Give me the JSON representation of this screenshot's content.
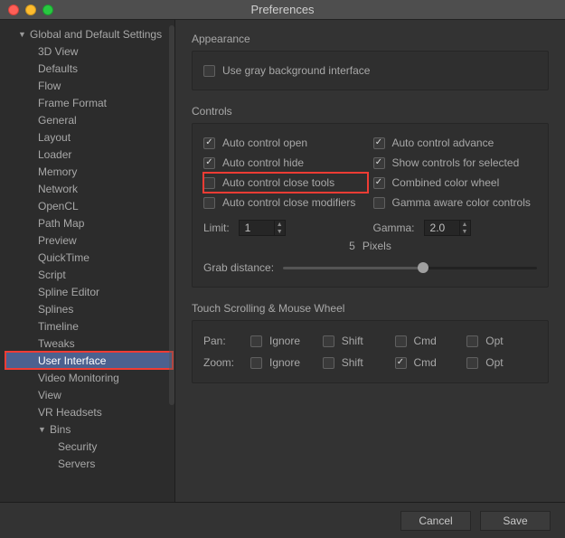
{
  "window": {
    "title": "Preferences"
  },
  "sidebar": {
    "root": {
      "label": "Global and Default Settings"
    },
    "items": [
      "3D View",
      "Defaults",
      "Flow",
      "Frame Format",
      "General",
      "Layout",
      "Loader",
      "Memory",
      "Network",
      "OpenCL",
      "Path Map",
      "Preview",
      "QuickTime",
      "Script",
      "Spline Editor",
      "Splines",
      "Timeline",
      "Tweaks",
      "User Interface",
      "Video Monitoring",
      "View",
      "VR Headsets"
    ],
    "bins": {
      "label": "Bins",
      "items": [
        "Security",
        "Servers"
      ]
    },
    "selected": "User Interface"
  },
  "appearance": {
    "title": "Appearance",
    "gray_bg": {
      "label": "Use gray background interface",
      "checked": false
    }
  },
  "controls": {
    "title": "Controls",
    "auto_open": {
      "label": "Auto control open",
      "checked": true
    },
    "auto_advance": {
      "label": "Auto control advance",
      "checked": true
    },
    "auto_hide": {
      "label": "Auto control hide",
      "checked": true
    },
    "show_selected": {
      "label": "Show controls for selected",
      "checked": true
    },
    "close_tools": {
      "label": "Auto control close tools",
      "checked": false
    },
    "combined_wheel": {
      "label": "Combined color wheel",
      "checked": true
    },
    "close_mods": {
      "label": "Auto control close modifiers",
      "checked": false
    },
    "gamma_aware": {
      "label": "Gamma aware color controls",
      "checked": false
    },
    "limit": {
      "label": "Limit:",
      "value": "1"
    },
    "gamma": {
      "label": "Gamma:",
      "value": "2.0"
    },
    "pixels_value": "5",
    "pixels_label": "Pixels",
    "grab_distance": {
      "label": "Grab distance:",
      "value_pct": 55
    }
  },
  "touch": {
    "title": "Touch Scrolling & Mouse Wheel",
    "mods": [
      "Ignore",
      "Shift",
      "Cmd",
      "Opt"
    ],
    "pan": {
      "label": "Pan:",
      "checked": [
        false,
        false,
        false,
        false
      ]
    },
    "zoom": {
      "label": "Zoom:",
      "checked": [
        false,
        false,
        true,
        false
      ]
    }
  },
  "footer": {
    "cancel": "Cancel",
    "save": "Save"
  }
}
